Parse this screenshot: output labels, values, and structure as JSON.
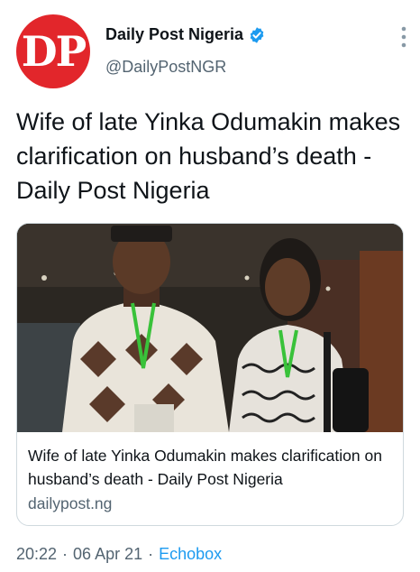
{
  "author": {
    "avatar_text": "DP",
    "display_name": "Daily Post Nigeria",
    "handle": "@DailyPostNGR",
    "verified": true,
    "avatar_color": "#e2262b",
    "verified_color": "#1d9bf0"
  },
  "tweet": {
    "text": "Wife of late Yinka Odumakin makes clarification on husband’s death - Daily Post Nigeria"
  },
  "card": {
    "title": "Wife of late Yinka Odumakin makes clarification on husband’s death - Daily Post Nigeria",
    "domain": "dailypost.ng"
  },
  "meta": {
    "time": "20:22",
    "date": "06 Apr 21",
    "separator": "·",
    "source": "Echobox"
  },
  "icons": {
    "verified": "verified-badge-icon",
    "more": "more-options-icon"
  }
}
